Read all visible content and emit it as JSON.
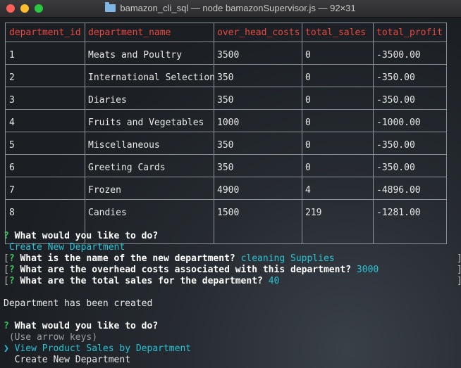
{
  "window": {
    "title": "bamazon_cli_sql — node bamazonSupervisor.js — 92×31",
    "colors": {
      "header": "#e9483f",
      "prompt": "#37c85a",
      "answer": "#28c3d6"
    }
  },
  "table": {
    "columns": [
      "department_id",
      "department_name",
      "over_head_costs",
      "total_sales",
      "total_profit"
    ],
    "rows": [
      [
        "1",
        "Meats and Poultry",
        "3500",
        "0",
        "-3500.00"
      ],
      [
        "2",
        "International Selection",
        "350",
        "0",
        "-350.00"
      ],
      [
        "3",
        "Diaries",
        "350",
        "0",
        "-350.00"
      ],
      [
        "4",
        "Fruits and Vegetables",
        "1000",
        "0",
        "-1000.00"
      ],
      [
        "5",
        "Miscellaneous",
        "350",
        "0",
        "-350.00"
      ],
      [
        "6",
        "Greeting Cards",
        "350",
        "0",
        "-350.00"
      ],
      [
        "7",
        "Frozen",
        "4900",
        "4",
        "-4896.00"
      ],
      [
        "8",
        "Candies",
        "1500",
        "219",
        "-1281.00"
      ]
    ]
  },
  "prompts": {
    "q_mark": "?",
    "what_to_do": "What would you like to do?",
    "selected_answer": "Create New Department",
    "name_question": "What is the name of the new department?",
    "name_answer": "cleaning Supplies",
    "overhead_question": "What are the overhead costs associated with this department?",
    "overhead_answer": "3000",
    "sales_question": "What are the total sales for the department?",
    "sales_answer": "40",
    "created_message": "Department has been created",
    "what_to_do_2": "What would you like to do?",
    "hint": "(Use arrow keys)",
    "pointer": "❯",
    "menu_items": [
      "View Product Sales by Department",
      "Create New Department"
    ]
  }
}
